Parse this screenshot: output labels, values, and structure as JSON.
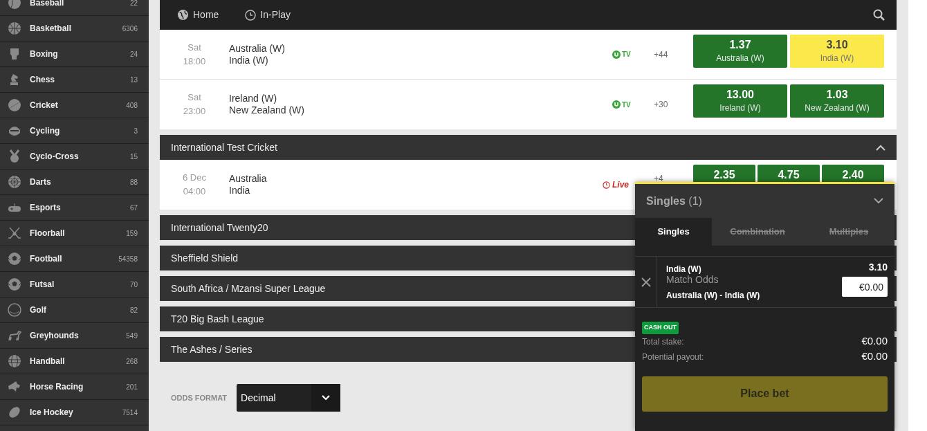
{
  "sidebar": {
    "items": [
      {
        "name": "Baseball",
        "count": "22"
      },
      {
        "name": "Basketball",
        "count": "6306"
      },
      {
        "name": "Boxing",
        "count": "24"
      },
      {
        "name": "Chess",
        "count": "13"
      },
      {
        "name": "Cricket",
        "count": "408"
      },
      {
        "name": "Cycling",
        "count": "3"
      },
      {
        "name": "Cyclo-Cross",
        "count": "15"
      },
      {
        "name": "Darts",
        "count": "88"
      },
      {
        "name": "Esports",
        "count": "67"
      },
      {
        "name": "Floorball",
        "count": "159"
      },
      {
        "name": "Football",
        "count": "54358"
      },
      {
        "name": "Futsal",
        "count": "70"
      },
      {
        "name": "Golf",
        "count": "82"
      },
      {
        "name": "Greyhounds",
        "count": "549"
      },
      {
        "name": "Handball",
        "count": "268"
      },
      {
        "name": "Horse Racing",
        "count": "201"
      },
      {
        "name": "Ice Hockey",
        "count": "7514"
      }
    ]
  },
  "nav": {
    "items": [
      {
        "label": "Home"
      },
      {
        "label": "In-Play"
      }
    ]
  },
  "top_events": [
    {
      "date": "Sat",
      "time": "18:00",
      "home": "Australia (W)",
      "away": "India (W)",
      "status": {
        "kind": "tv",
        "label": "TV"
      },
      "markets": "+44",
      "odds": [
        {
          "price": "1.37",
          "label": "Australia (W)",
          "selected": false
        },
        {
          "price": "3.10",
          "label": "India (W)",
          "selected": true
        }
      ]
    },
    {
      "date": "Sat",
      "time": "23:00",
      "home": "Ireland (W)",
      "away": "New Zealand (W)",
      "status": {
        "kind": "tv",
        "label": "TV"
      },
      "markets": "+30",
      "odds": [
        {
          "price": "13.00",
          "label": "Ireland (W)",
          "selected": false
        },
        {
          "price": "1.03",
          "label": "New Zealand (W)",
          "selected": false
        }
      ]
    }
  ],
  "competitions": [
    {
      "title": "International Test Cricket",
      "expanded": true,
      "events": [
        {
          "date": "6 Dec",
          "time": "04:00",
          "home": "Australia",
          "away": "India",
          "status": {
            "kind": "live",
            "label": "Live"
          },
          "markets": "+4",
          "odds": [
            {
              "price": "2.35",
              "selected": false
            },
            {
              "price": "4.75",
              "selected": false
            },
            {
              "price": "2.40",
              "selected": false
            }
          ]
        }
      ]
    },
    {
      "title": "International Twenty20",
      "expanded": false
    },
    {
      "title": "Sheffield Shield",
      "expanded": false
    },
    {
      "title": "South Africa / Mzansi Super League",
      "expanded": false
    },
    {
      "title": "T20 Big Bash League",
      "expanded": false
    },
    {
      "title": "The Ashes / Series",
      "expanded": false
    }
  ],
  "odds_format": {
    "label": "ODDS FORMAT",
    "value": "Decimal"
  },
  "bet_slip": {
    "title": "Singles",
    "count": "(1)",
    "tabs": [
      {
        "label": "Singles",
        "selected": true,
        "disabled": false
      },
      {
        "label": "Combination",
        "selected": false,
        "disabled": true
      },
      {
        "label": "Multiples",
        "selected": false,
        "disabled": true
      }
    ],
    "selection": {
      "name": "India (W)",
      "market": "Match Odds",
      "event": "Australia (W) - India (W)",
      "price": "3.10",
      "stake": "€0.00"
    },
    "cash_out": "CASH OUT",
    "totals": [
      {
        "label": "Total stake:",
        "value": "€0.00"
      },
      {
        "label": "Potential payout:",
        "value": "€0.00"
      }
    ],
    "place_bet": {
      "label": "Place bet",
      "disabled": true
    }
  }
}
